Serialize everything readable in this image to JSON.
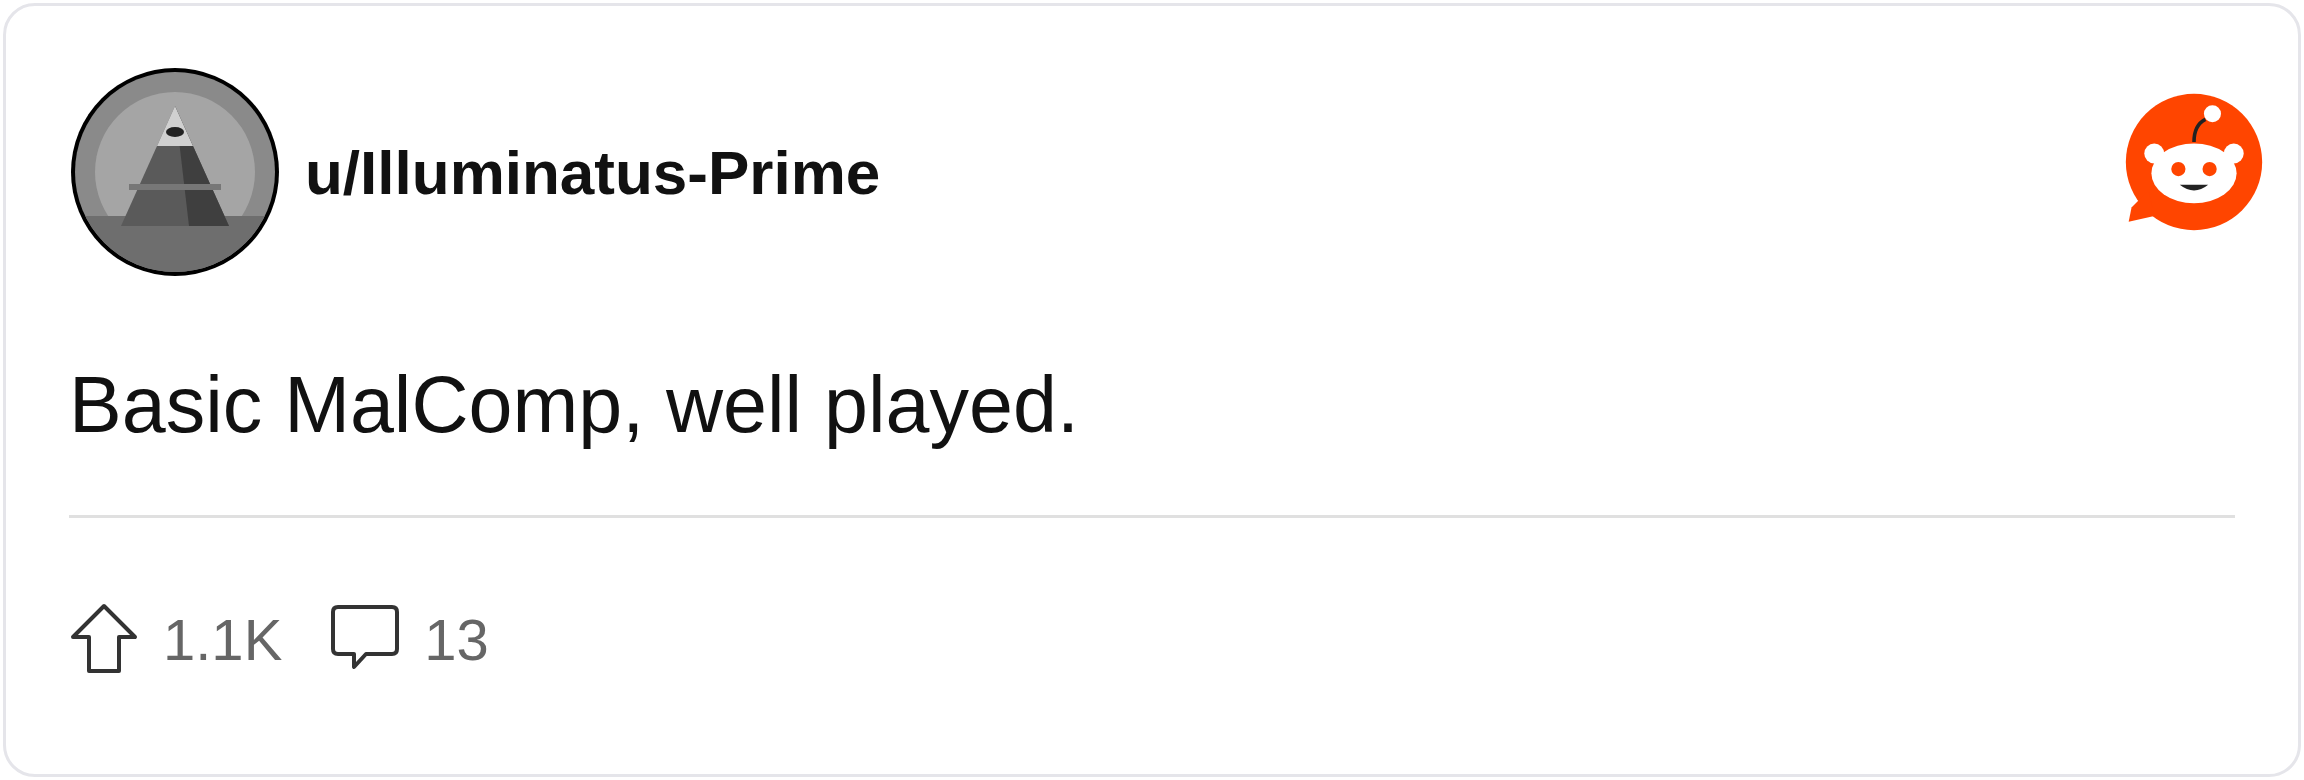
{
  "author": {
    "username": "u/Illuminatus-Prime"
  },
  "body": "Basic MalComp, well played.",
  "stats": {
    "upvotes": "1.1K",
    "comments": "13"
  }
}
